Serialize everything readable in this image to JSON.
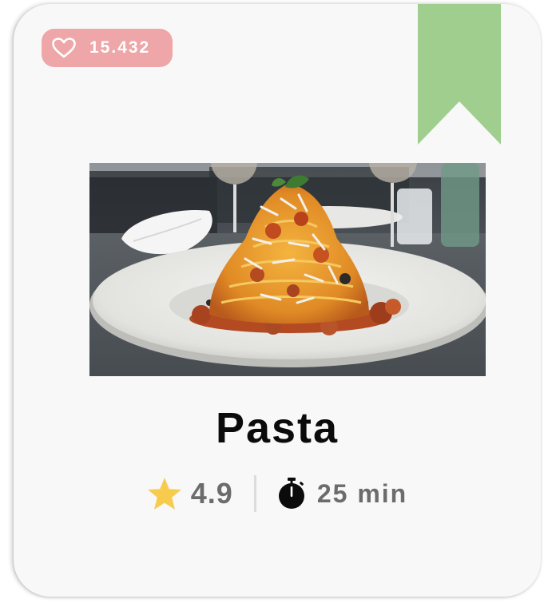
{
  "recipe": {
    "likes": "15.432",
    "title": "Pasta",
    "rating": "4.9",
    "time": "25 min"
  },
  "icons": {
    "like": "heart-outline-icon",
    "bookmark": "bookmark-ribbon-icon",
    "rating": "star-icon",
    "time": "stopwatch-icon"
  },
  "colors": {
    "like_badge": "#eea6a8",
    "bookmark": "#9fce8f",
    "star": "#f7cc4e",
    "text_muted": "#6c6c6c",
    "title": "#0b0b0b"
  }
}
